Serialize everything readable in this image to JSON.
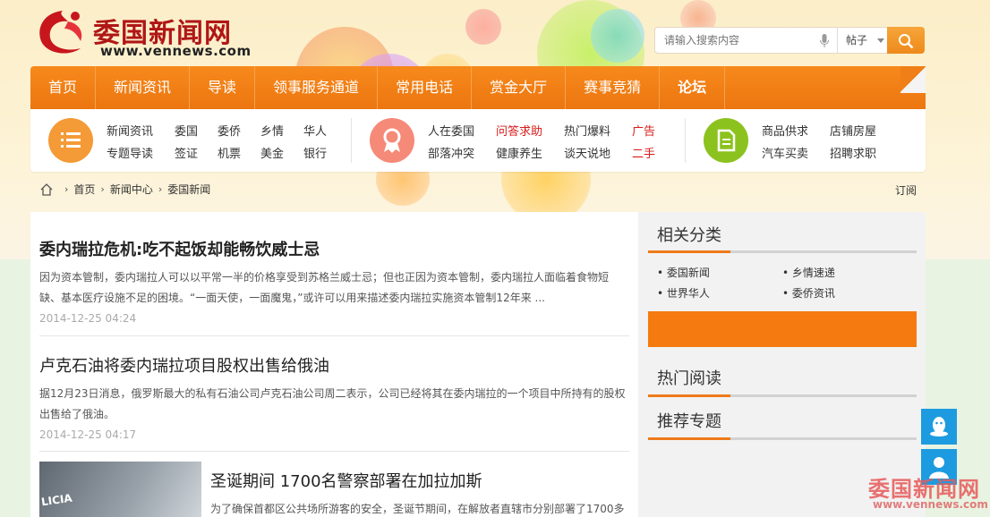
{
  "header": {
    "logo_title": "委国新闻网",
    "logo_url": "www.vennews.com",
    "search_placeholder": "请输入搜索内容",
    "search_scope": "帖子"
  },
  "nav": [
    "首页",
    "新闻资讯",
    "导读",
    "领事服务通道",
    "常用电话",
    "赏金大厅",
    "赛事竞猜",
    "论坛"
  ],
  "subnav": {
    "group1": [
      "新闻资讯",
      "委国",
      "委侨",
      "乡情",
      "华人",
      "专题导读",
      "签证",
      "机票",
      "美金",
      "银行"
    ],
    "group2": [
      "人在委国",
      "问答求助",
      "热门爆料",
      "广告",
      "部落冲突",
      "健康养生",
      "谈天说地",
      "二手"
    ],
    "group3": [
      "商品供求",
      "店铺房屋",
      "汽车买卖",
      "招聘求职"
    ]
  },
  "breadcrumb": [
    "首页",
    "新闻中心",
    "委国新闻"
  ],
  "subscribe": "订阅",
  "articles": [
    {
      "title": "委内瑞拉危机:吃不起饭却能畅饮威士忌",
      "desc": "因为资本管制，委内瑞拉人可以以平常一半的价格享受到苏格兰威士忌；但也正因为资本管制，委内瑞拉人面临着食物短缺、基本医疗设施不足的困境。“一面天使，一面魔鬼，”或许可以用来描述委内瑞拉实施资本管制12年来 ...",
      "date": "2014-12-25 04:24"
    },
    {
      "title": "卢克石油将委内瑞拉项目股权出售给俄油",
      "desc": "据12月23日消息，俄罗斯最大的私有石油公司卢克石油公司周二表示，公司已经将其在委内瑞拉的一个项目中所持有的股权出售给了俄油。",
      "date": "2014-12-25 04:17"
    },
    {
      "title": "圣诞期间 1700名警察部署在加拉加斯",
      "desc": "为了确保首都区公共场所游客的安全，圣诞节期间，在解放者直辖市分别部署了1700多",
      "thumb_text": "LICIA"
    }
  ],
  "sidebar": {
    "related_title": "相关分类",
    "categories": [
      "委国新闻",
      "乡情速递",
      "世界华人",
      "委侨资讯"
    ],
    "hot_title": "热门阅读",
    "topic_title": "推荐专题"
  },
  "watermark": {
    "title": "委国新闻网",
    "url": "www.vennews.com"
  },
  "colors": {
    "accent": "#ef7a1a",
    "brand_red": "#b01616",
    "float_blue": "#1d9be0",
    "icon_orange": "#f49a36",
    "icon_coral": "#f58a78",
    "icon_green": "#8cc21e"
  }
}
